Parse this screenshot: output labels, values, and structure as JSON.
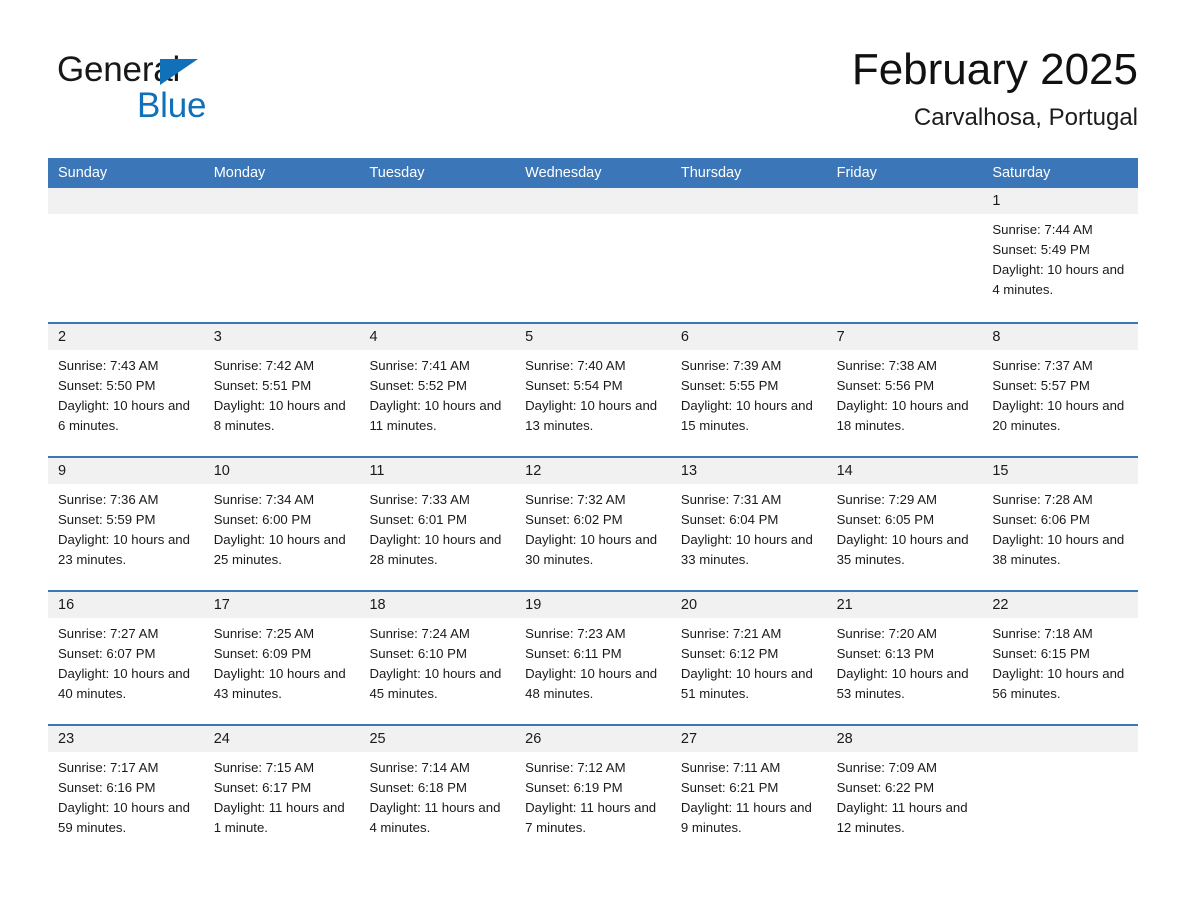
{
  "brand": {
    "name_part1": "General",
    "name_part2": "Blue",
    "flag_icon": "triangle-flag-icon",
    "accent_color": "#1070b8"
  },
  "header": {
    "month_title": "February 2025",
    "location": "Carvalhosa, Portugal"
  },
  "theme": {
    "header_blue": "#3a76b8",
    "row_divider_blue": "#3a76b8",
    "day_band_gray": "#f1f1f1",
    "text_color": "#1a1a1a"
  },
  "weekdays": [
    "Sunday",
    "Monday",
    "Tuesday",
    "Wednesday",
    "Thursday",
    "Friday",
    "Saturday"
  ],
  "weeks": [
    [
      {
        "day": "",
        "sunrise": "",
        "sunset": "",
        "daylight": ""
      },
      {
        "day": "",
        "sunrise": "",
        "sunset": "",
        "daylight": ""
      },
      {
        "day": "",
        "sunrise": "",
        "sunset": "",
        "daylight": ""
      },
      {
        "day": "",
        "sunrise": "",
        "sunset": "",
        "daylight": ""
      },
      {
        "day": "",
        "sunrise": "",
        "sunset": "",
        "daylight": ""
      },
      {
        "day": "",
        "sunrise": "",
        "sunset": "",
        "daylight": ""
      },
      {
        "day": "1",
        "sunrise": "Sunrise: 7:44 AM",
        "sunset": "Sunset: 5:49 PM",
        "daylight": "Daylight: 10 hours and 4 minutes."
      }
    ],
    [
      {
        "day": "2",
        "sunrise": "Sunrise: 7:43 AM",
        "sunset": "Sunset: 5:50 PM",
        "daylight": "Daylight: 10 hours and 6 minutes."
      },
      {
        "day": "3",
        "sunrise": "Sunrise: 7:42 AM",
        "sunset": "Sunset: 5:51 PM",
        "daylight": "Daylight: 10 hours and 8 minutes."
      },
      {
        "day": "4",
        "sunrise": "Sunrise: 7:41 AM",
        "sunset": "Sunset: 5:52 PM",
        "daylight": "Daylight: 10 hours and 11 minutes."
      },
      {
        "day": "5",
        "sunrise": "Sunrise: 7:40 AM",
        "sunset": "Sunset: 5:54 PM",
        "daylight": "Daylight: 10 hours and 13 minutes."
      },
      {
        "day": "6",
        "sunrise": "Sunrise: 7:39 AM",
        "sunset": "Sunset: 5:55 PM",
        "daylight": "Daylight: 10 hours and 15 minutes."
      },
      {
        "day": "7",
        "sunrise": "Sunrise: 7:38 AM",
        "sunset": "Sunset: 5:56 PM",
        "daylight": "Daylight: 10 hours and 18 minutes."
      },
      {
        "day": "8",
        "sunrise": "Sunrise: 7:37 AM",
        "sunset": "Sunset: 5:57 PM",
        "daylight": "Daylight: 10 hours and 20 minutes."
      }
    ],
    [
      {
        "day": "9",
        "sunrise": "Sunrise: 7:36 AM",
        "sunset": "Sunset: 5:59 PM",
        "daylight": "Daylight: 10 hours and 23 minutes."
      },
      {
        "day": "10",
        "sunrise": "Sunrise: 7:34 AM",
        "sunset": "Sunset: 6:00 PM",
        "daylight": "Daylight: 10 hours and 25 minutes."
      },
      {
        "day": "11",
        "sunrise": "Sunrise: 7:33 AM",
        "sunset": "Sunset: 6:01 PM",
        "daylight": "Daylight: 10 hours and 28 minutes."
      },
      {
        "day": "12",
        "sunrise": "Sunrise: 7:32 AM",
        "sunset": "Sunset: 6:02 PM",
        "daylight": "Daylight: 10 hours and 30 minutes."
      },
      {
        "day": "13",
        "sunrise": "Sunrise: 7:31 AM",
        "sunset": "Sunset: 6:04 PM",
        "daylight": "Daylight: 10 hours and 33 minutes."
      },
      {
        "day": "14",
        "sunrise": "Sunrise: 7:29 AM",
        "sunset": "Sunset: 6:05 PM",
        "daylight": "Daylight: 10 hours and 35 minutes."
      },
      {
        "day": "15",
        "sunrise": "Sunrise: 7:28 AM",
        "sunset": "Sunset: 6:06 PM",
        "daylight": "Daylight: 10 hours and 38 minutes."
      }
    ],
    [
      {
        "day": "16",
        "sunrise": "Sunrise: 7:27 AM",
        "sunset": "Sunset: 6:07 PM",
        "daylight": "Daylight: 10 hours and 40 minutes."
      },
      {
        "day": "17",
        "sunrise": "Sunrise: 7:25 AM",
        "sunset": "Sunset: 6:09 PM",
        "daylight": "Daylight: 10 hours and 43 minutes."
      },
      {
        "day": "18",
        "sunrise": "Sunrise: 7:24 AM",
        "sunset": "Sunset: 6:10 PM",
        "daylight": "Daylight: 10 hours and 45 minutes."
      },
      {
        "day": "19",
        "sunrise": "Sunrise: 7:23 AM",
        "sunset": "Sunset: 6:11 PM",
        "daylight": "Daylight: 10 hours and 48 minutes."
      },
      {
        "day": "20",
        "sunrise": "Sunrise: 7:21 AM",
        "sunset": "Sunset: 6:12 PM",
        "daylight": "Daylight: 10 hours and 51 minutes."
      },
      {
        "day": "21",
        "sunrise": "Sunrise: 7:20 AM",
        "sunset": "Sunset: 6:13 PM",
        "daylight": "Daylight: 10 hours and 53 minutes."
      },
      {
        "day": "22",
        "sunrise": "Sunrise: 7:18 AM",
        "sunset": "Sunset: 6:15 PM",
        "daylight": "Daylight: 10 hours and 56 minutes."
      }
    ],
    [
      {
        "day": "23",
        "sunrise": "Sunrise: 7:17 AM",
        "sunset": "Sunset: 6:16 PM",
        "daylight": "Daylight: 10 hours and 59 minutes."
      },
      {
        "day": "24",
        "sunrise": "Sunrise: 7:15 AM",
        "sunset": "Sunset: 6:17 PM",
        "daylight": "Daylight: 11 hours and 1 minute."
      },
      {
        "day": "25",
        "sunrise": "Sunrise: 7:14 AM",
        "sunset": "Sunset: 6:18 PM",
        "daylight": "Daylight: 11 hours and 4 minutes."
      },
      {
        "day": "26",
        "sunrise": "Sunrise: 7:12 AM",
        "sunset": "Sunset: 6:19 PM",
        "daylight": "Daylight: 11 hours and 7 minutes."
      },
      {
        "day": "27",
        "sunrise": "Sunrise: 7:11 AM",
        "sunset": "Sunset: 6:21 PM",
        "daylight": "Daylight: 11 hours and 9 minutes."
      },
      {
        "day": "28",
        "sunrise": "Sunrise: 7:09 AM",
        "sunset": "Sunset: 6:22 PM",
        "daylight": "Daylight: 11 hours and 12 minutes."
      },
      {
        "day": "",
        "sunrise": "",
        "sunset": "",
        "daylight": ""
      }
    ]
  ]
}
